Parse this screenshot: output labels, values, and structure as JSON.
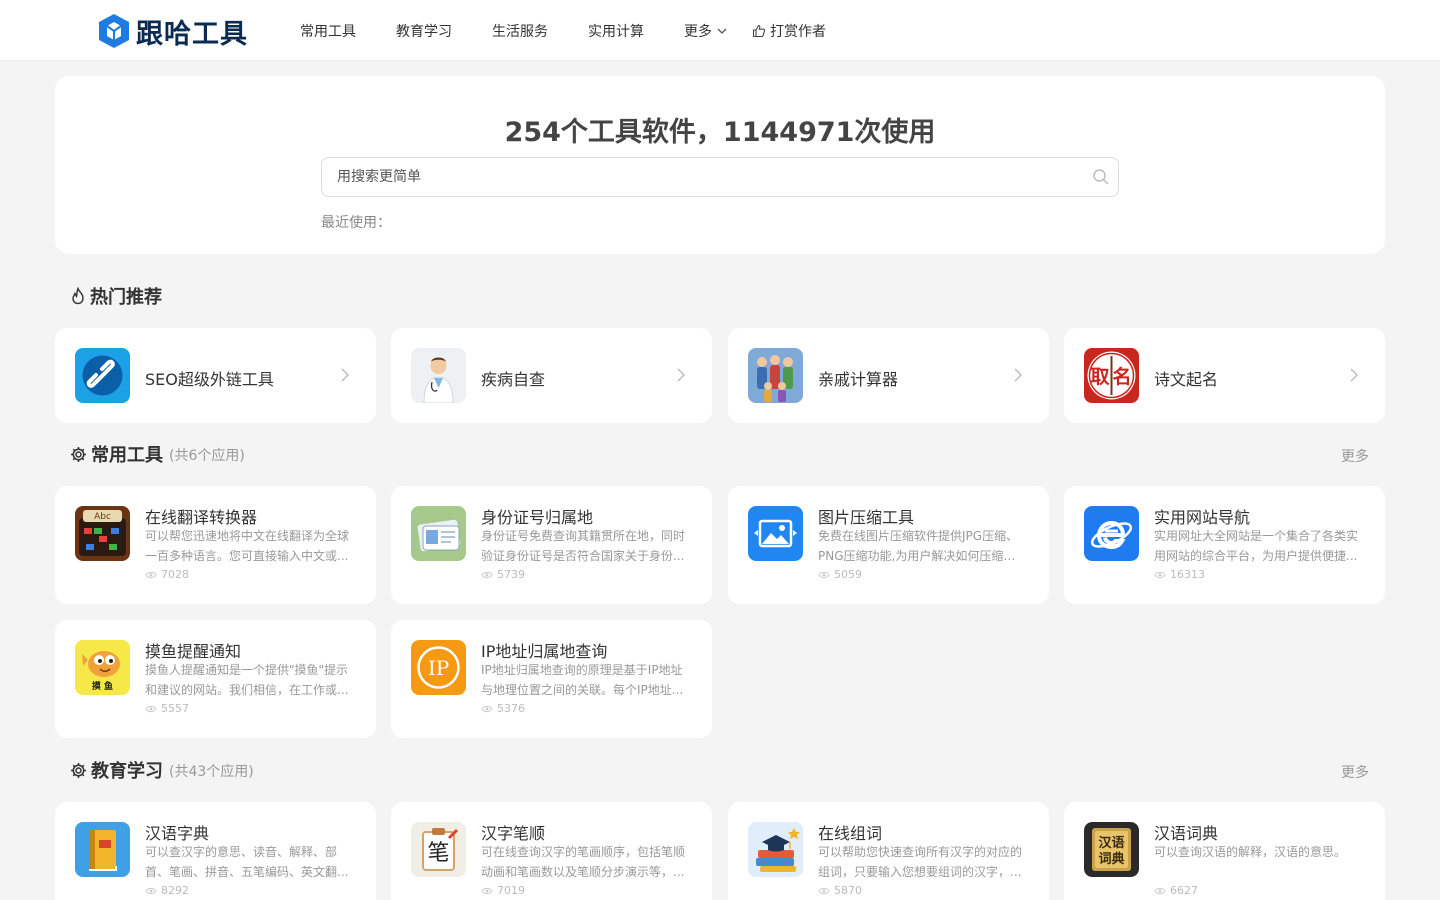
{
  "header": {
    "logo_text": "跟哈工具",
    "nav": [
      "常用工具",
      "教育学习",
      "生活服务",
      "实用计算",
      "更多"
    ],
    "donate": "打赏作者"
  },
  "hero": {
    "title": "254个工具软件，1144971次使用",
    "search_placeholder": "用搜索更简单",
    "recent_label": "最近使用："
  },
  "hot": {
    "title": "热门推荐",
    "items": [
      {
        "name": "SEO超级外链工具",
        "icon": "link-icon"
      },
      {
        "name": "疾病自查",
        "icon": "doctor-icon"
      },
      {
        "name": "亲戚计算器",
        "icon": "family-icon"
      },
      {
        "name": "诗文起名",
        "icon": "naming-icon"
      }
    ]
  },
  "common": {
    "title": "常用工具",
    "count": "(共6个应用)",
    "more": "更多",
    "items": [
      {
        "name": "在线翻译转换器",
        "desc": "可以帮您迅速地将中文在线翻译为全球一百多种语言。您可直接输入中文或...",
        "views": "7028",
        "icon": "translate-icon"
      },
      {
        "name": "身份证号归属地",
        "desc": "身份证号免费查询其籍贯所在地，同时验证身份证号是否符合国家关于身份...",
        "views": "5739",
        "icon": "id-card-icon"
      },
      {
        "name": "图片压缩工具",
        "desc": "免费在线图片压缩软件提供JPG压缩、PNG压缩功能,为用户解决如何压缩图...",
        "views": "5059",
        "icon": "image-icon"
      },
      {
        "name": "实用网站导航",
        "desc": "实用网址大全网站是一个集合了各类实用网站的综合平台，为用户提供便捷...",
        "views": "16313",
        "icon": "browser-icon"
      },
      {
        "name": "摸鱼提醒通知",
        "desc": "摸鱼人提醒通知是一个提供\"摸鱼\"提示和建议的网站。我们相信，在工作或...",
        "views": "5557",
        "icon": "fish-icon"
      },
      {
        "name": "IP地址归属地查询",
        "desc": "IP地址归属地查询的原理是基于IP地址与地理位置之间的关联。每个IP地址...",
        "views": "5376",
        "icon": "ip-icon"
      }
    ]
  },
  "edu": {
    "title": "教育学习",
    "count": "(共43个应用)",
    "more": "更多",
    "items": [
      {
        "name": "汉语字典",
        "desc": "可以查汉字的意思、读音、解释、部首、笔画、拼音、五笔编码、英文翻...",
        "views": "8292",
        "icon": "dictionary-icon"
      },
      {
        "name": "汉字笔顺",
        "desc": "可在线查询汉字的笔画顺序，包括笔顺动画和笔画数以及笔顺分步演示等，...",
        "views": "7019",
        "icon": "stroke-icon"
      },
      {
        "name": "在线组词",
        "desc": "可以帮助您快速查询所有汉字的对应的组词，只要输入您想要组词的汉字，...",
        "views": "5870",
        "icon": "books-icon"
      },
      {
        "name": "汉语词典",
        "desc": "可以查询汉语的解释，汉语的意思。",
        "views": "6627",
        "icon": "cidian-icon"
      }
    ]
  },
  "icon_text": {
    "naming": [
      "取",
      "名"
    ],
    "translate": "Abc",
    "fish": "摸  鱼",
    "ip": "IP",
    "stroke": "笔",
    "cidian": [
      "汉语",
      "词典"
    ]
  }
}
